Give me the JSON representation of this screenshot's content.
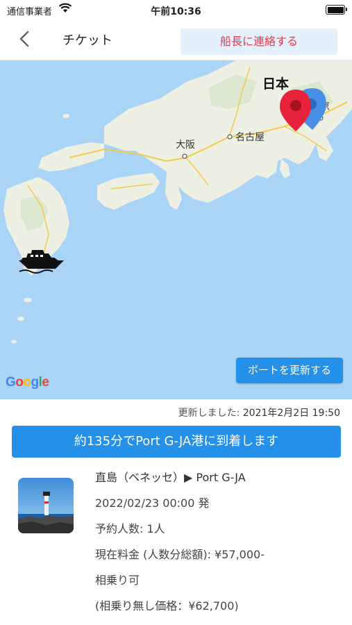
{
  "status_bar": {
    "carrier": "通信事業者",
    "time": "午前10:36",
    "wifi_icon": "wifi-icon",
    "battery_icon": "battery-icon",
    "battery_level": 1.0
  },
  "nav": {
    "back_icon": "chevron-left-icon",
    "title": "チケット",
    "contact_button": "船長に連絡する"
  },
  "map": {
    "labels": {
      "japan": "日本",
      "tokyo": "東京",
      "osaka": "大阪",
      "nagoya": "名古屋"
    },
    "update_boat_button": "ボートを更新する",
    "google_logo": "Google",
    "google_colors": [
      "#4285F4",
      "#EA4335",
      "#FBBC05",
      "#4285F4",
      "#34A853",
      "#EA4335"
    ],
    "pins": [
      {
        "name": "destination-pin",
        "color": "#e8233c"
      },
      {
        "name": "current-location-pin",
        "color": "#4a8fe6"
      }
    ],
    "boat_icon": "boat-icon"
  },
  "ticket": {
    "updated_label": "更新しました:",
    "updated_value": "2021年2月2日 19:50",
    "arrival_message": "約135分でPort G-JA港に到着します",
    "route": "直島（ベネッセ）▶ Port G-JA",
    "departure": "2022/02/23 00:00 発",
    "passengers": "予約人数: 1人",
    "current_fare": "現在料金 (人数分総額): ¥57,000-",
    "rideshare": "相乗り可",
    "price_without_rideshare": "(相乗り無し価格：¥62,700)"
  },
  "colors": {
    "accent": "#2490e8",
    "contact_bg": "#e4f0fc",
    "contact_text": "#e8394a",
    "sea": "#a9d4f6",
    "land": "#eef0e4"
  }
}
